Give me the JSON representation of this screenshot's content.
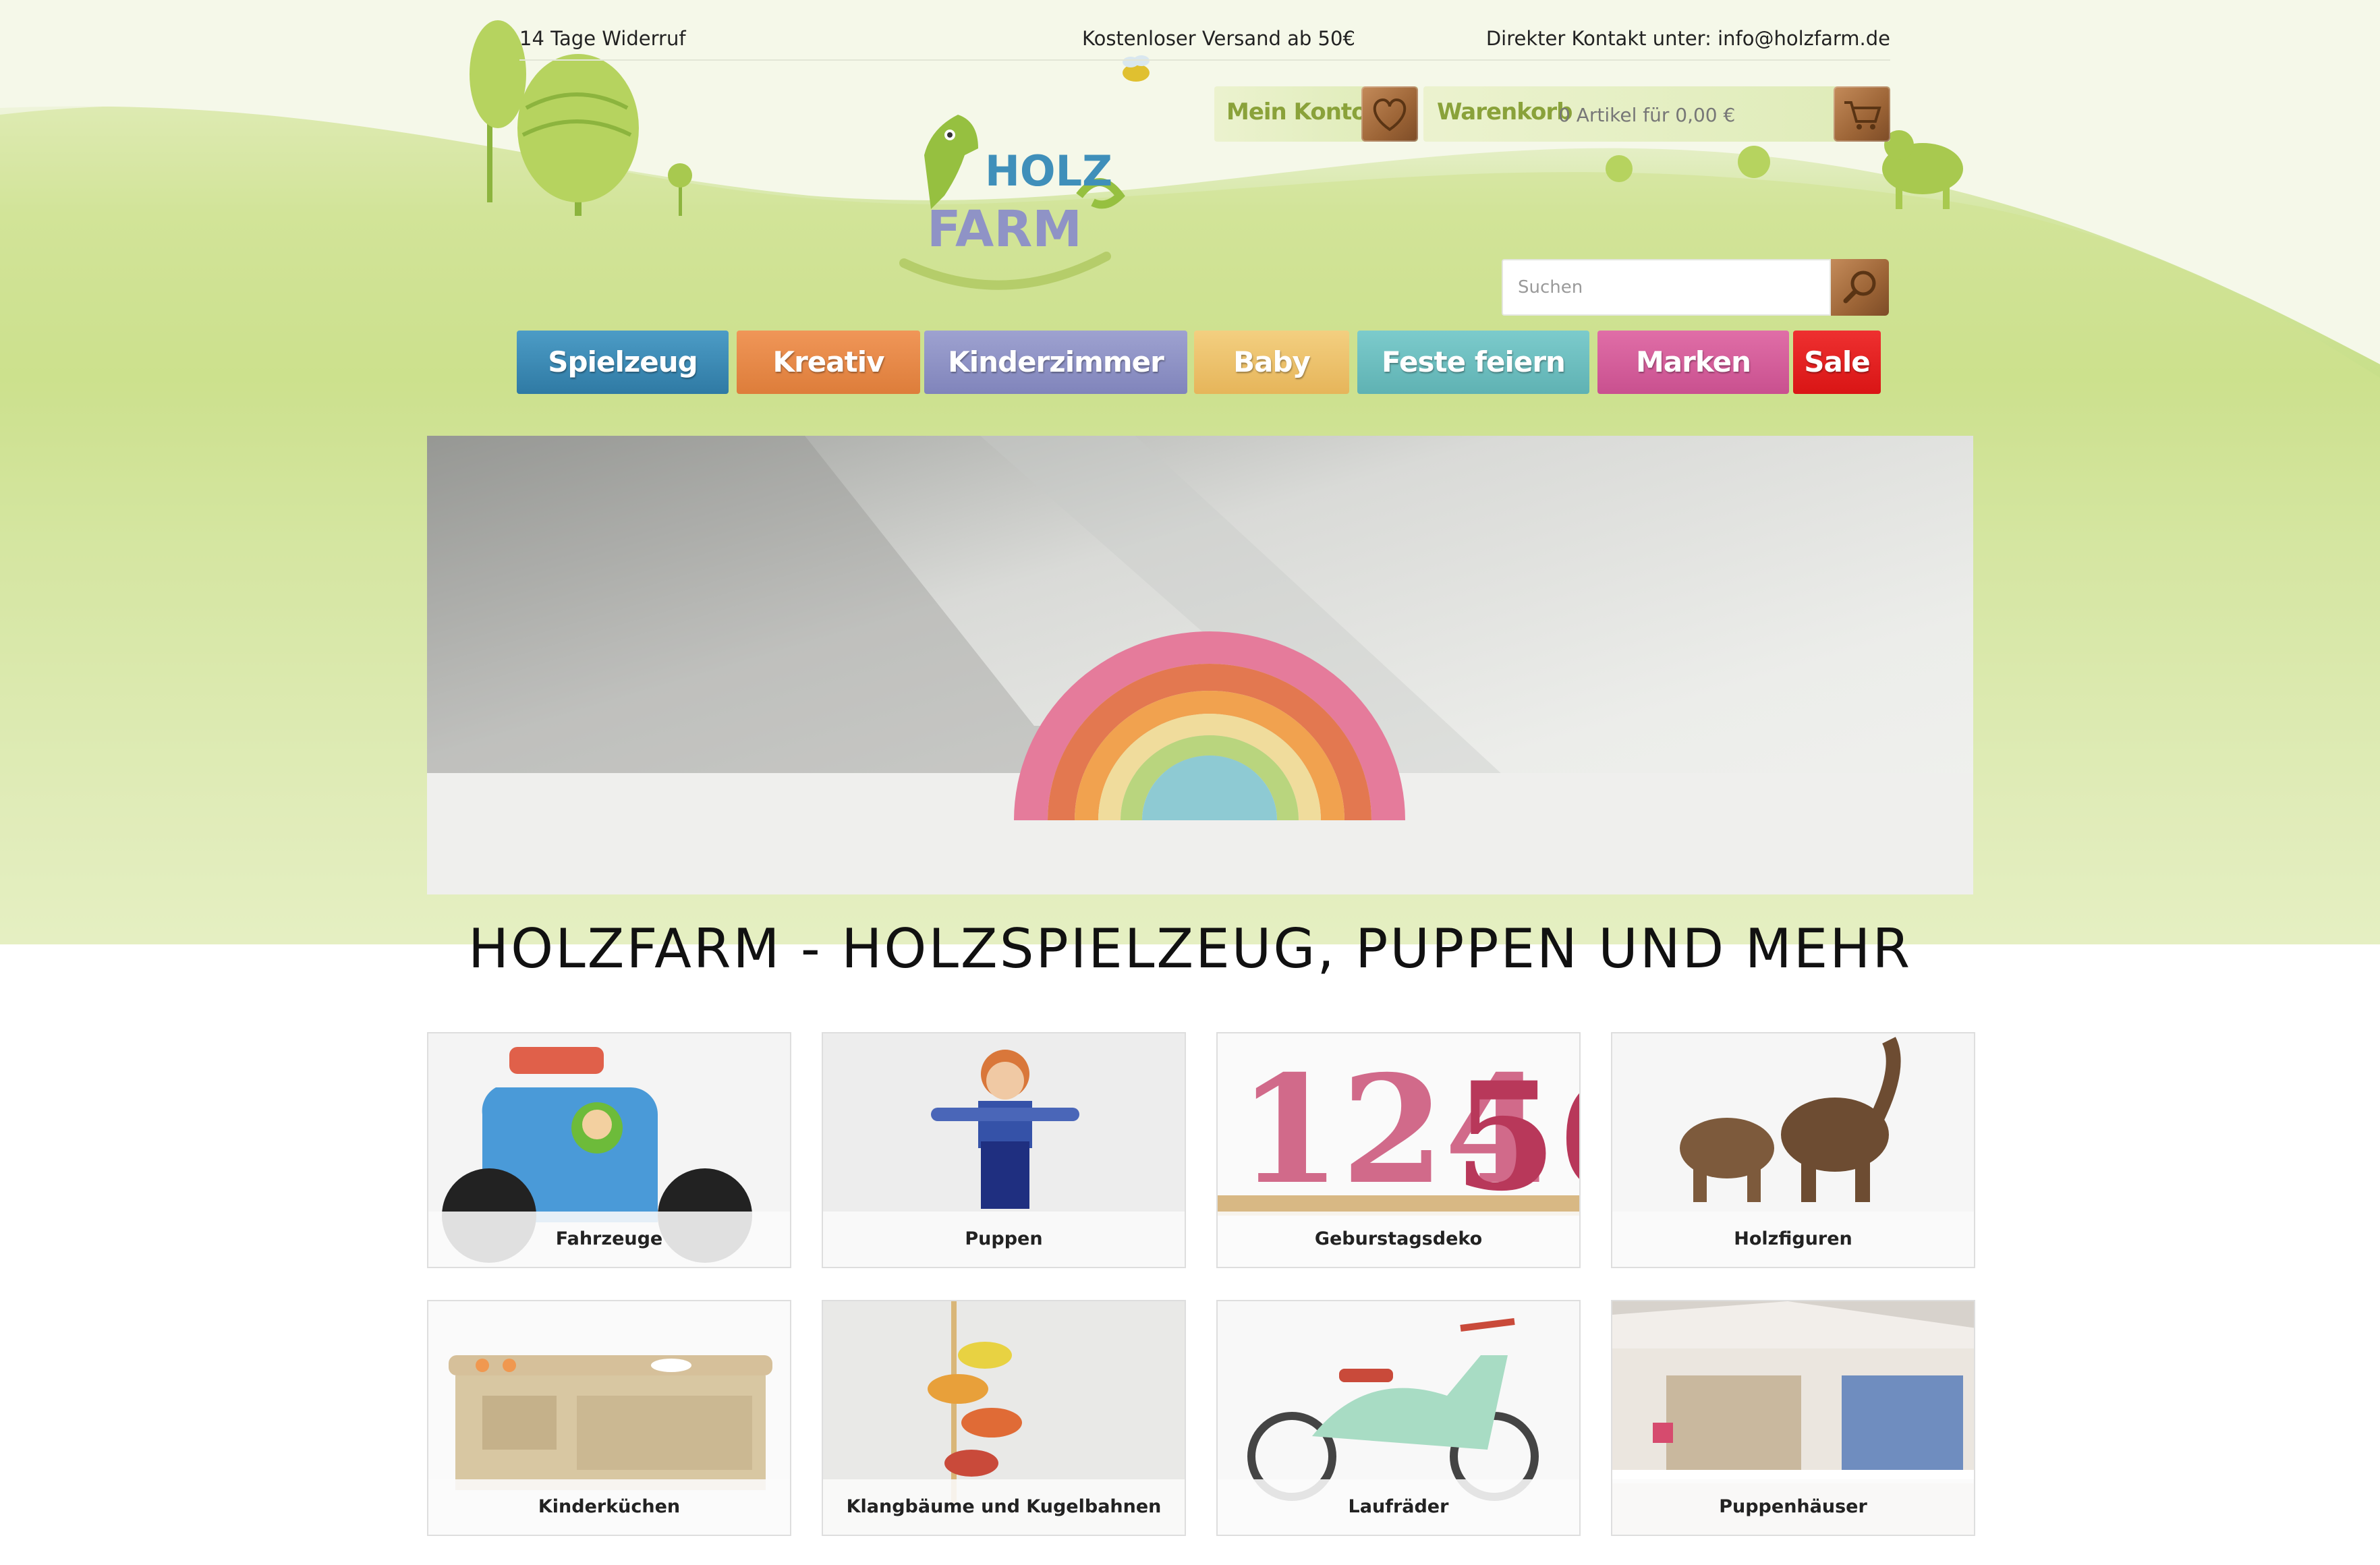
{
  "topbar": {
    "withdrawal": "14 Tage Widerruf",
    "shipping": "Kostenloser Versand ab 50€",
    "contact": "Direkter Kontakt unter: info@holzfarm.de"
  },
  "logo": {
    "line1": "HOLZ",
    "line2": "FARM"
  },
  "account": {
    "label": "Mein Konto",
    "icon": "heart-icon"
  },
  "cart": {
    "label": "Warenkorb",
    "info": "0 Artikel  für 0,00 €",
    "icon": "cart-icon"
  },
  "search": {
    "placeholder": "Suchen",
    "icon": "magnifier-icon"
  },
  "nav": [
    {
      "label": "Spielzeug",
      "color": "#3f8fba"
    },
    {
      "label": "Kreativ",
      "color": "#e88a47"
    },
    {
      "label": "Kinderzimmer",
      "color": "#8f93c6"
    },
    {
      "label": "Baby",
      "color": "#ecc26a"
    },
    {
      "label": "Feste feiern",
      "color": "#6fbfc0"
    },
    {
      "label": "Marken",
      "color": "#d75e9c"
    },
    {
      "label": "Sale",
      "color": "#e52222"
    }
  ],
  "page_title": "HOLZFARM - HOLZSPIELZEUG, PUPPEN UND MEHR",
  "categories": [
    {
      "label": "Fahrzeuge"
    },
    {
      "label": "Puppen"
    },
    {
      "label": "Geburstagsdeko"
    },
    {
      "label": "Holzfiguren"
    },
    {
      "label": "Kinderküchen"
    },
    {
      "label": "Klangbäume und Kugelbahnen"
    },
    {
      "label": "Laufräder"
    },
    {
      "label": "Puppenhäuser"
    }
  ]
}
